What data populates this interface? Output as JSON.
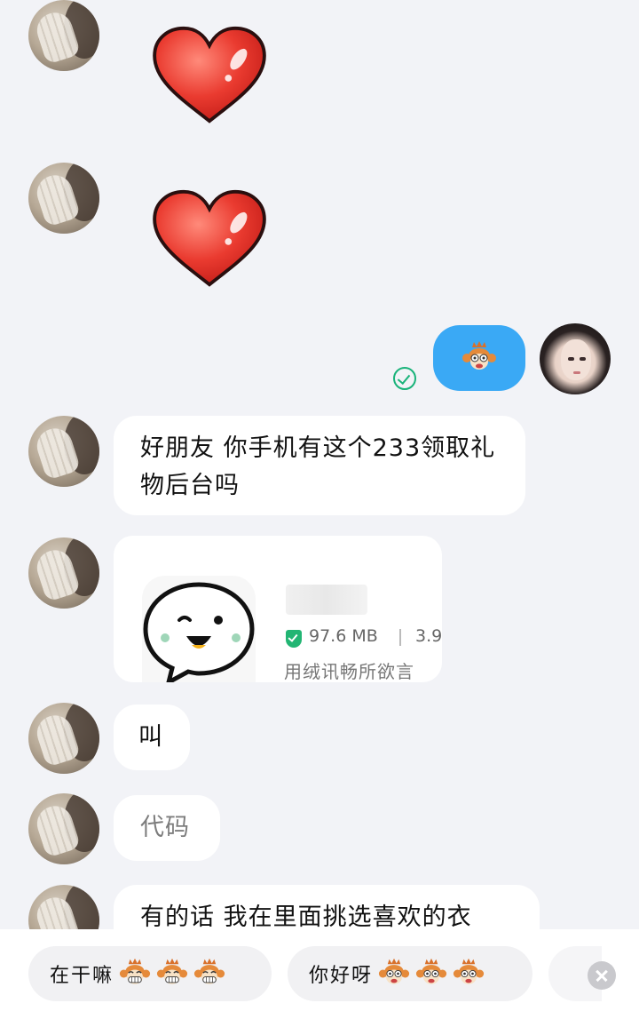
{
  "messages": {
    "m4_text": "好朋友 你手机有这个233领取礼物后台吗",
    "m6_text": "叫",
    "m7_text": "代码",
    "m8_text": "有的话 我在里面挑选喜欢的衣"
  },
  "app_card": {
    "size": "97.6 MB",
    "rating": "3.9",
    "slogan": "用绒讯畅所欲言"
  },
  "quick_replies": [
    {
      "label": "在干嘛"
    },
    {
      "label": "你好呀"
    }
  ],
  "icons": [
    "heart-sticker",
    "monkey-emoji",
    "sent-check-icon",
    "chat-bubble-app-icon",
    "shield-check-icon",
    "grin-monkey-emoji",
    "close-icon"
  ],
  "colors": {
    "background": "#f2f3f7",
    "outgoing_bubble": "#3aa9f5",
    "heart_red": "#e8302a",
    "check_green": "#19b37a"
  }
}
